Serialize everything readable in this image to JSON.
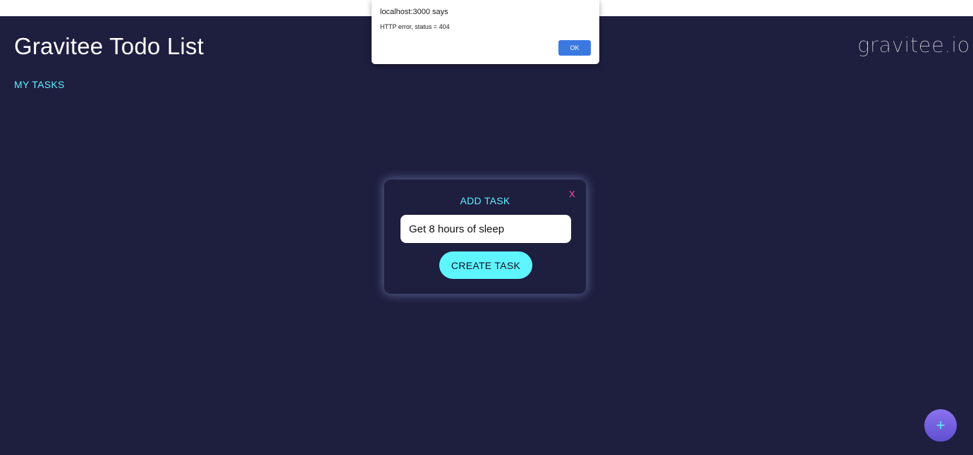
{
  "app": {
    "title": "Gravitee Todo List",
    "logo_text": "gravitee.io",
    "nav_my_tasks": "MY TASKS",
    "background_color": "#1e1e3f",
    "accent_color": "#5ff0ff"
  },
  "add_task_modal": {
    "title": "ADD TASK",
    "close_label": "X",
    "input_value": "Get 8 hours of sleep",
    "create_button_label": "CREATE TASK",
    "close_color": "#ff4fa3"
  },
  "fab": {
    "label": "+",
    "icon": "plus-icon"
  },
  "browser_alert": {
    "title": "localhost:3000 says",
    "message": "HTTP error, status = 404",
    "ok_label": "OK",
    "button_color": "#3b79e0"
  }
}
